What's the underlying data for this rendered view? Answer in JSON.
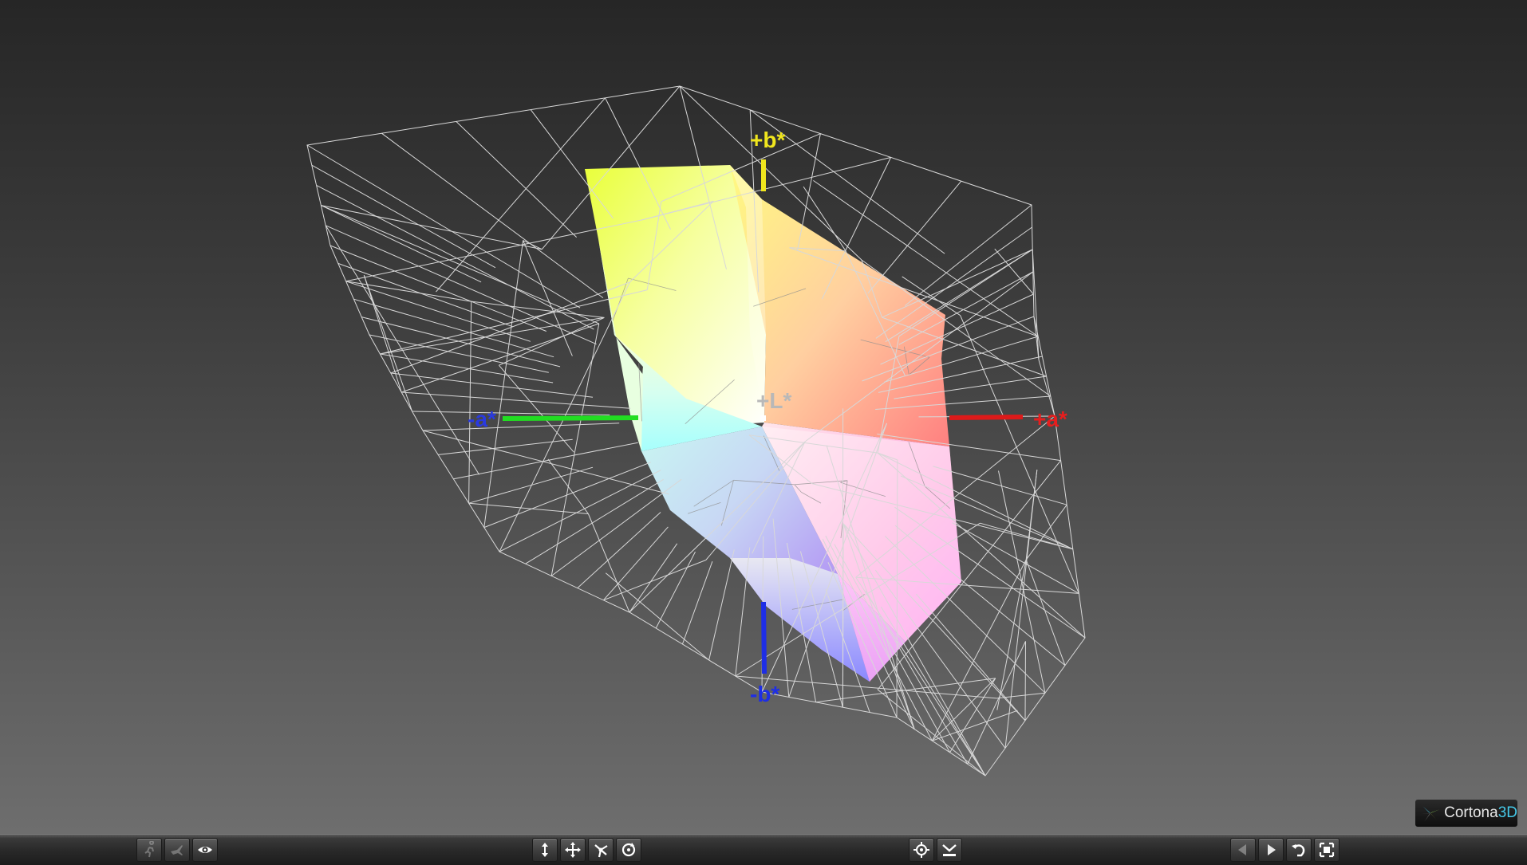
{
  "viewer": {
    "name": "Cortona3D",
    "logo_word": "Cortona",
    "logo_suffix": "3D"
  },
  "axes": {
    "plus_b": {
      "label": "+b*",
      "color": "#f0e61e"
    },
    "minus_b": {
      "label": "-b*",
      "color": "#1e2ee6"
    },
    "plus_a": {
      "label": "+a*",
      "color": "#e61e1e"
    },
    "minus_a": {
      "label": "-a*",
      "color": "#2a3ae0"
    },
    "plus_L": {
      "label": "+L*",
      "color": "#a0a0a0"
    }
  },
  "colors": {
    "wireframe": "#d8d8d8",
    "minus_a_axis_line": "#22dd22",
    "plus_a_axis_line": "#dd1a1a",
    "plus_b_axis_line": "#f0e61e",
    "minus_b_axis_line": "#1e2ee6"
  },
  "toolbar": {
    "left_group": [
      {
        "name": "navigate-back-icon",
        "title": "Previous",
        "enabled": false
      },
      {
        "name": "fly-icon",
        "title": "Fly",
        "enabled": false
      },
      {
        "name": "examine-eye-icon",
        "title": "Study",
        "enabled": true
      }
    ],
    "center_group": [
      {
        "name": "plan-arrows-icon",
        "title": "Plan"
      },
      {
        "name": "pan-arrows-icon",
        "title": "Pan"
      },
      {
        "name": "turn-icon",
        "title": "Turn"
      },
      {
        "name": "roll-icon",
        "title": "Roll"
      }
    ],
    "view_group": [
      {
        "name": "goto-target-icon",
        "title": "Go To"
      },
      {
        "name": "align-icon",
        "title": "Align"
      }
    ],
    "right_group": [
      {
        "name": "previous-view-icon",
        "title": "Previous Viewpoint"
      },
      {
        "name": "next-view-icon",
        "title": "Next Viewpoint"
      },
      {
        "name": "restore-icon",
        "title": "Restore"
      },
      {
        "name": "fit-icon",
        "title": "Fit"
      }
    ]
  }
}
